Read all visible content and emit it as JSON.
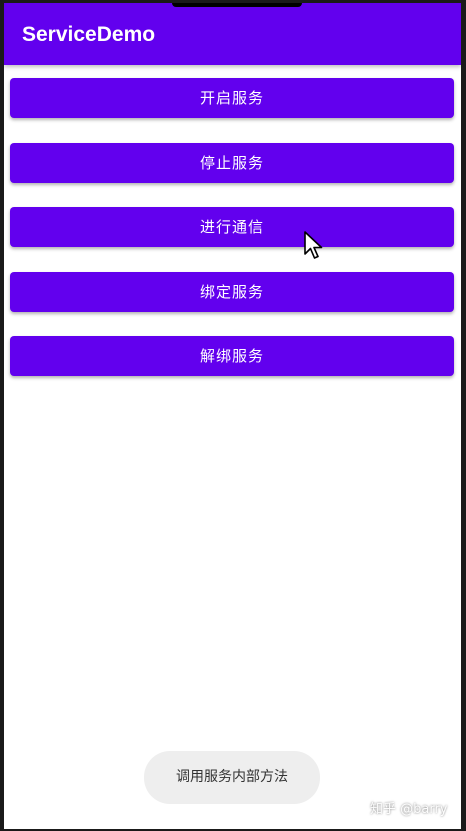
{
  "app": {
    "title": "ServiceDemo",
    "accent_color": "#6200EE"
  },
  "buttons": [
    {
      "label": "开启服务"
    },
    {
      "label": "停止服务"
    },
    {
      "label": "进行通信"
    },
    {
      "label": "绑定服务"
    },
    {
      "label": "解绑服务"
    }
  ],
  "toast": {
    "message": "调用服务内部方法"
  },
  "watermark": {
    "text": "知乎 @barry"
  },
  "cursor": {
    "icon": "arrow-cursor-icon"
  }
}
